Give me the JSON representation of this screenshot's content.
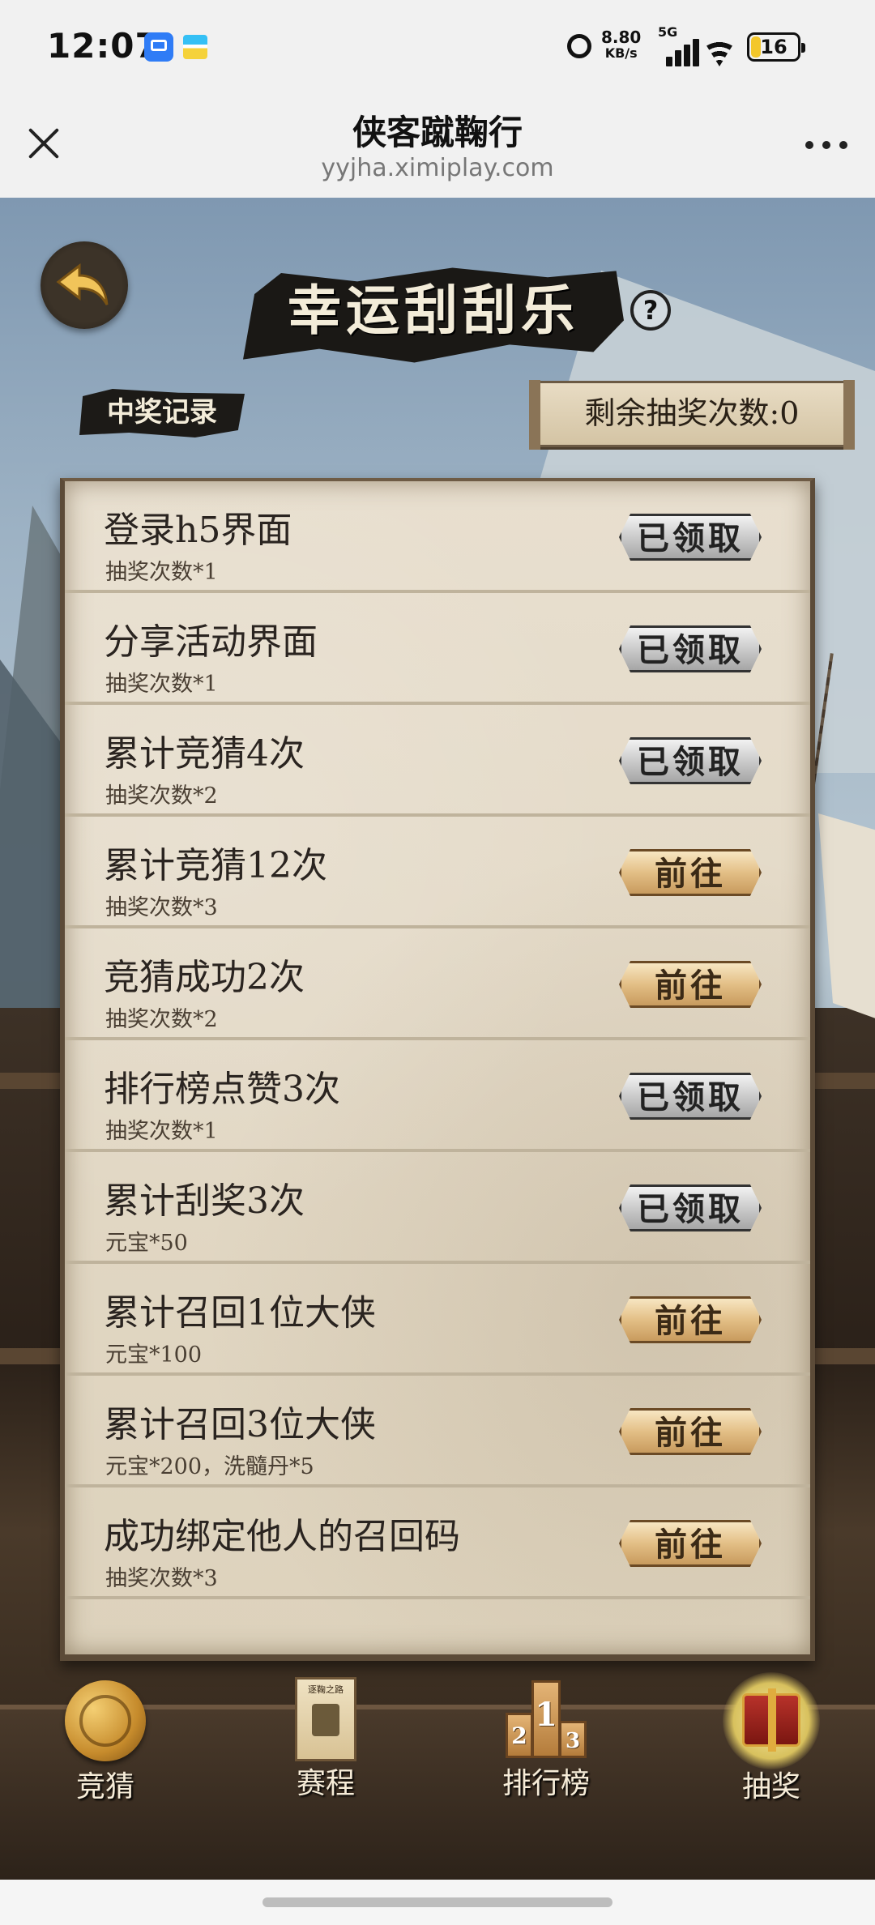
{
  "status_bar": {
    "time": "12:07",
    "net_speed_value": "8.80",
    "net_speed_unit": "KB/s",
    "network": "5G",
    "battery": "16"
  },
  "browser_nav": {
    "title": "侠客蹴鞠行",
    "url": "yyjha.ximiplay.com"
  },
  "game": {
    "title": "幸运刮刮乐",
    "help_label": "?",
    "records_tab": "中奖记录",
    "remaining_draws": "剩余抽奖次数:0"
  },
  "tasks": [
    {
      "title": "登录h5界面",
      "reward": "抽奖次数*1",
      "button": "已领取",
      "state": "done"
    },
    {
      "title": "分享活动界面",
      "reward": "抽奖次数*1",
      "button": "已领取",
      "state": "done"
    },
    {
      "title": "累计竞猜4次",
      "reward": "抽奖次数*2",
      "button": "已领取",
      "state": "done"
    },
    {
      "title": "累计竞猜12次",
      "reward": "抽奖次数*3",
      "button": "前往",
      "state": "go"
    },
    {
      "title": "竞猜成功2次",
      "reward": "抽奖次数*2",
      "button": "前往",
      "state": "go"
    },
    {
      "title": "排行榜点赞3次",
      "reward": "抽奖次数*1",
      "button": "已领取",
      "state": "done"
    },
    {
      "title": "累计刮奖3次",
      "reward": "元宝*50",
      "button": "已领取",
      "state": "done"
    },
    {
      "title": "累计召回1位大侠",
      "reward": "元宝*100",
      "button": "前往",
      "state": "go"
    },
    {
      "title": "累计召回3位大侠",
      "reward": "元宝*200，洗髓丹*5",
      "button": "前往",
      "state": "go"
    },
    {
      "title": "成功绑定他人的召回码",
      "reward": "抽奖次数*3",
      "button": "前往",
      "state": "go"
    }
  ],
  "bottom_nav": {
    "items": [
      {
        "label": "竞猜",
        "icon": "ball-icon"
      },
      {
        "label": "赛程",
        "icon": "scroll-icon",
        "icon_text": "逐鞠之路"
      },
      {
        "label": "排行榜",
        "icon": "podium-icon",
        "ranks": [
          "1",
          "2",
          "3"
        ]
      },
      {
        "label": "抽奖",
        "icon": "treasure-chest-icon"
      }
    ]
  },
  "colors": {
    "done_button": "#cfcfcf",
    "go_button": "#e3bf86",
    "scroll_paper": "#e8dfcf"
  }
}
